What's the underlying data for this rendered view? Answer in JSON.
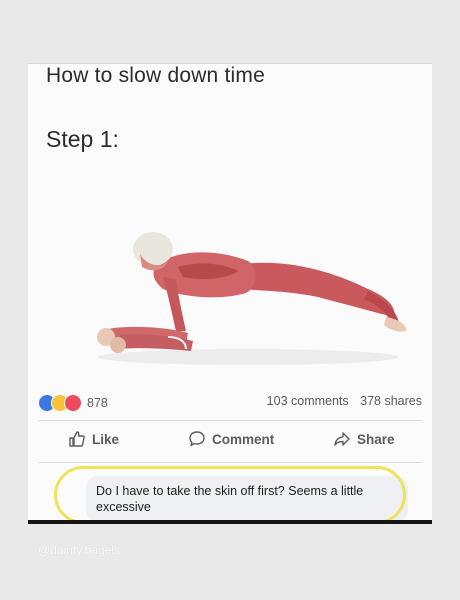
{
  "post": {
    "title": "How to slow down time",
    "step": "Step 1:",
    "image_description_icon": "anatomy-plank-figure"
  },
  "stats": {
    "reaction_icons": [
      "like-reaction-icon",
      "haha-reaction-icon",
      "love-reaction-icon"
    ],
    "reactions_count": "878",
    "comments": "103 comments",
    "shares": "378 shares"
  },
  "actions": {
    "like": "Like",
    "comment": "Comment",
    "share": "Share"
  },
  "comment": {
    "text": "Do I have to take the skin off first? Seems a little excessive"
  },
  "watermark": "@dainty.bagels",
  "colors": {
    "like_blue": "#3a79e0",
    "haha_yellow": "#f6c23a",
    "love_red": "#ef4a5e",
    "highlight_yellow": "#f0e35a"
  }
}
